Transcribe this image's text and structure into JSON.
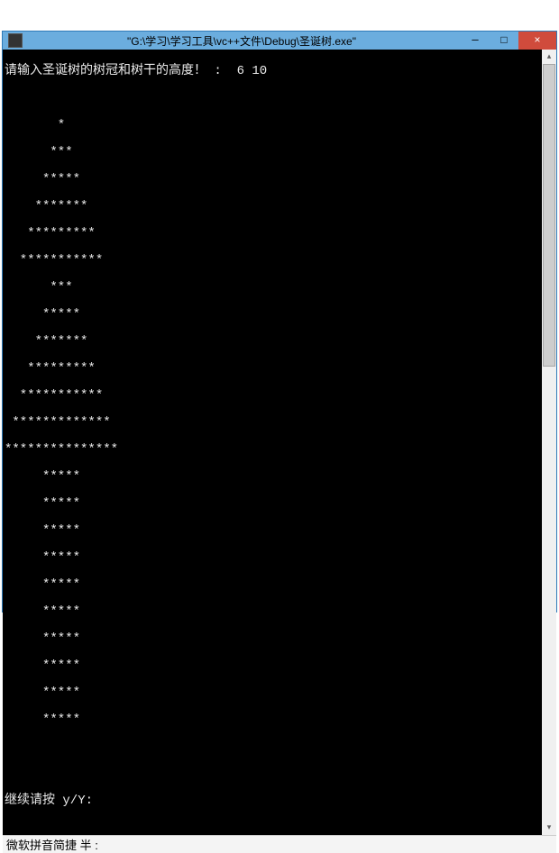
{
  "titlebar": {
    "title": "\"G:\\学习\\学习工具\\vc++文件\\Debug\\圣诞树.exe\"",
    "minimize": "─",
    "maximize": "□",
    "close": "×"
  },
  "console": {
    "prompt_line": "请输入圣诞树的树冠和树干的高度！ :  6 10",
    "blank": " ",
    "tree01": "       *",
    "tree02": "      ***",
    "tree03": "     *****",
    "tree04": "    *******",
    "tree05": "   *********",
    "tree06": "  ***********",
    "tree07": "      ***",
    "tree08": "     *****",
    "tree09": "    *******",
    "tree10": "   *********",
    "tree11": "  ***********",
    "tree12": " *************",
    "tree13": "***************",
    "trunk01": "     *****",
    "trunk02": "     *****",
    "trunk03": "     *****",
    "trunk04": "     *****",
    "trunk05": "     *****",
    "trunk06": "     *****",
    "trunk07": "     *****",
    "trunk08": "     *****",
    "trunk09": "     *****",
    "trunk10": "     *****",
    "continue_prompt": "继续请按 y/Y:"
  },
  "scrollbar": {
    "up": "▴",
    "down": "▾"
  },
  "ime": {
    "text": "微软拼音简捷 半 :"
  }
}
